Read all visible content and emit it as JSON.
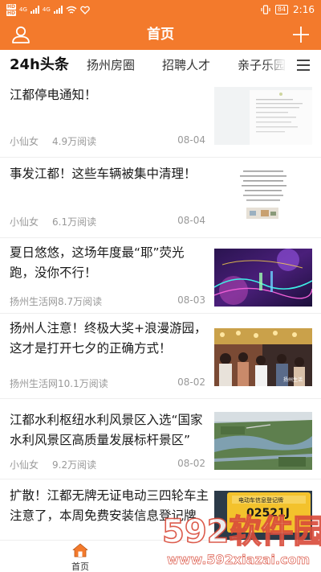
{
  "status_bar": {
    "hd_top": "HD",
    "hd_bottom": "HD",
    "network_1": "4G",
    "network_2": "4G",
    "battery": "84",
    "time": "2:16"
  },
  "header": {
    "title": "首页"
  },
  "tabs": [
    {
      "label": "24h头条",
      "active": true
    },
    {
      "label": "扬州房圈",
      "active": false
    },
    {
      "label": "招聘人才",
      "active": false
    },
    {
      "label": "亲子乐园",
      "active": false
    }
  ],
  "articles": [
    {
      "title": "江都停电通知！",
      "source": "小仙女",
      "reads": "4.9万阅读",
      "date": "08-04",
      "thumb": "document"
    },
    {
      "title": "事发江都！这些车辆被集中清理！",
      "source": "小仙女",
      "reads": "6.1万阅读",
      "date": "08-04",
      "thumb": "notice"
    },
    {
      "title": "夏日悠悠，这场年度最“耶”荧光跑，没你不行！",
      "source": "扬州生活网",
      "reads": "8.7万阅读",
      "date": "08-03",
      "thumb": "neon"
    },
    {
      "title": "扬州人注意！终极大奖+浪漫游园，这才是打开七夕的正确方式！",
      "source": "扬州生活网",
      "reads": "10.1万阅读",
      "date": "08-02",
      "thumb": "crowd"
    },
    {
      "title": "江都水利枢纽水利风景区入选“国家水利风景区高质量发展标杆景区”",
      "source": "小仙女",
      "reads": "9.2万阅读",
      "date": "08-02",
      "thumb": "aerial"
    },
    {
      "title": "扩散！江都无牌无证电动三四轮车主注意了，本周免费安装信息登记牌",
      "source": "",
      "reads": "",
      "date": "",
      "thumb": "plate"
    }
  ],
  "thumb_text": {
    "plate_top": "电动车信息登记牌",
    "plate_number": "02521J",
    "crowd_caption": "扬州生活"
  },
  "bottom_nav": {
    "home_label": "首页"
  },
  "watermark": {
    "brand": "592软件园",
    "url": "www.592xiazai.com"
  },
  "colors": {
    "brand": "#f37a2c",
    "meta_text": "#999999",
    "divider": "#eeeeee"
  },
  "icons": [
    "user-icon",
    "plus-icon",
    "menu-icon",
    "home-icon"
  ]
}
